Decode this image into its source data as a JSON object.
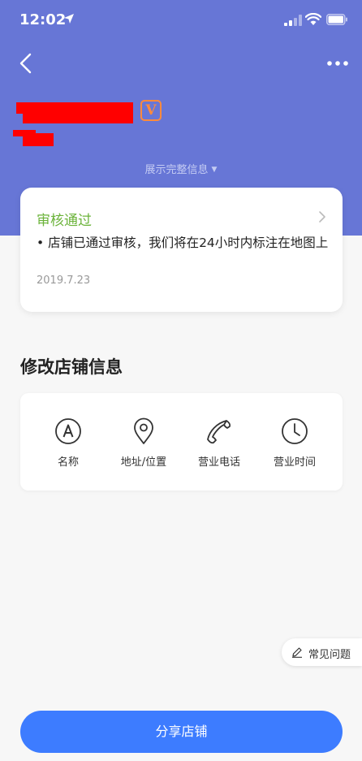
{
  "status_bar": {
    "time": "12:02"
  },
  "header": {
    "expand_label": "展示完整信息",
    "badge": "V"
  },
  "review": {
    "status": "审核通过",
    "description": "• 店铺已通过审核，我们将在24小时内标注在地图上",
    "date": "2019.7.23"
  },
  "edit_section": {
    "title": "修改店铺信息",
    "items": [
      {
        "label": "名称",
        "icon": "name-a-icon"
      },
      {
        "label": "地址/位置",
        "icon": "location-pin-icon"
      },
      {
        "label": "营业电话",
        "icon": "phone-icon"
      },
      {
        "label": "营业时间",
        "icon": "clock-icon"
      }
    ]
  },
  "faq": {
    "label": "常见问题",
    "icon": "pencil-icon"
  },
  "share": {
    "label": "分享店铺"
  },
  "colors": {
    "header_bg": "#6776d6",
    "approved_green": "#6bb33a",
    "primary_blue": "#3d7cff",
    "badge_orange": "#ff8a3d"
  }
}
